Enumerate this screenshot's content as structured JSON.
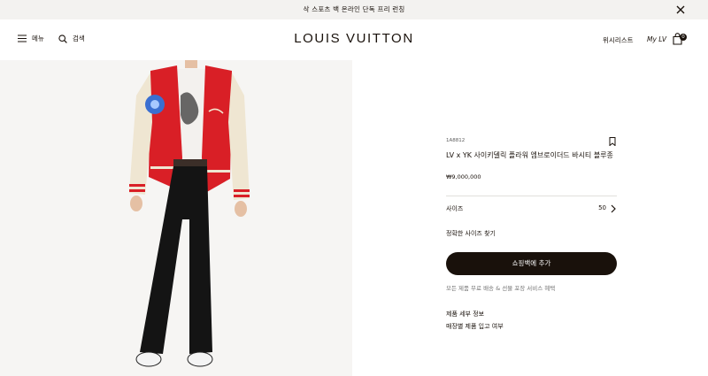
{
  "announcement": {
    "text": "삭 스포츠 백 온라인 단독 프리 런칭"
  },
  "header": {
    "menu_label": "메뉴",
    "search_label": "검색",
    "brand": "LOUIS VUITTON",
    "wishlist_label": "위시리스트",
    "mylv_label": "My LV",
    "bag_count": "0"
  },
  "product": {
    "sku": "1A8812",
    "name": "LV x YK 사이키델릭 플라워 엠브로이더드 바시티 블루종",
    "price": "₩9,000,000",
    "size_label": "사이즈",
    "size_value": "50",
    "size_guide": "정확한 사이즈 찾기",
    "add_to_cart": "쇼핑백에 추가",
    "shipping_note": "모든 제품 무료 배송 & 선물 포장 서비스 혜택",
    "details_link": "제품 세부 정보",
    "stock_link": "매장별 제품 입고 여부"
  },
  "colors": {
    "text": "#19110b",
    "jacket_red": "#d91f26",
    "sleeve_cream": "#efe6d2",
    "photo_bg": "#f6f5f3",
    "announcement_bg": "#f3f2f0"
  }
}
